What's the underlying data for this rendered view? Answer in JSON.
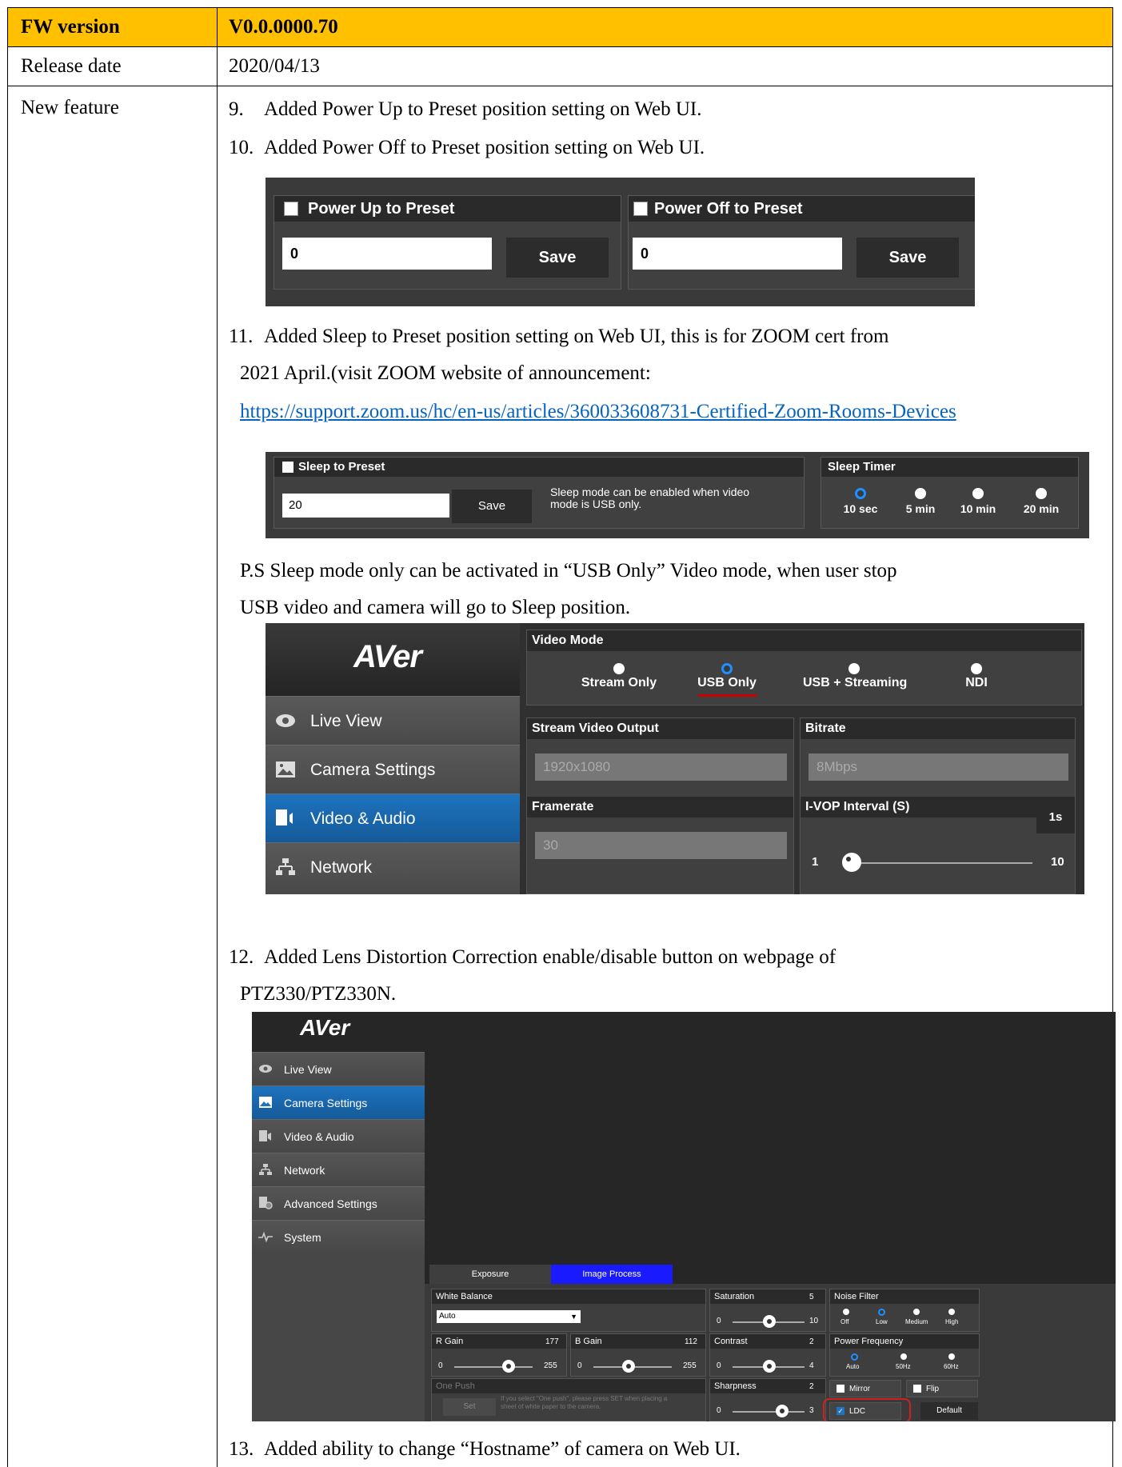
{
  "table": {
    "fw_label": "FW version",
    "fw_value": "V0.0.0000.70",
    "release_label": "Release date",
    "release_value": "2020/04/13",
    "feature_label": "New feature"
  },
  "items": [
    {
      "num": "9.",
      "text": "Added Power Up to Preset position setting on Web UI."
    },
    {
      "num": "10.",
      "text": "Added Power Off to Preset position setting on Web UI."
    },
    {
      "num": "11.",
      "text": "Added Sleep to Preset position setting on Web UI, this is for ZOOM cert from"
    },
    {
      "num": "12.",
      "text": "Added Lens Distortion Correction enable/disable button on webpage of"
    },
    {
      "num": "13.",
      "text": "Added ability to change “Hostname” of camera on Web UI."
    }
  ],
  "item11_line2": "2021 April.(visit ZOOM website of announcement:",
  "item11_link": "https://support.zoom.us/hc/en-us/articles/360033608731-Certified-Zoom-Rooms-Devices",
  "ps_line1": "P.S Sleep mode only can be activated in “USB Only” Video mode, when user stop",
  "ps_line2": "USB video and camera will go to Sleep position.",
  "item12_line2": "PTZ330/PTZ330N.",
  "shot_preset": {
    "power_up": {
      "label": "Power Up to Preset",
      "value": "0",
      "save": "Save"
    },
    "power_off": {
      "label": "Power Off to Preset",
      "value": "0",
      "save": "Save"
    }
  },
  "shot_sleep": {
    "label": "Sleep to Preset",
    "value": "20",
    "save": "Save",
    "note_line1": "Sleep mode can be enabled when video",
    "note_line2": "mode is USB only.",
    "timer_label": "Sleep Timer",
    "options": [
      "10 sec",
      "5 min",
      "10 min",
      "20 min"
    ],
    "selected": "10 sec"
  },
  "shot_video": {
    "logo": "AVer",
    "nav": [
      "Live View",
      "Camera Settings",
      "Video & Audio",
      "Network"
    ],
    "nav_selected": "Video & Audio",
    "video_mode_label": "Video Mode",
    "modes": [
      "Stream Only",
      "USB Only",
      "USB + Streaming",
      "NDI"
    ],
    "mode_selected": "USB Only",
    "stream_output_label": "Stream Video Output",
    "stream_output_value": "1920x1080",
    "bitrate_label": "Bitrate",
    "bitrate_value": "8Mbps",
    "framerate_label": "Framerate",
    "framerate_value": "30",
    "ivop_label": "I-VOP Interval (S)",
    "ivop_value": "1s",
    "ivop_min": "1",
    "ivop_max": "10"
  },
  "shot_camera": {
    "logo": "AVer",
    "nav": [
      "Live View",
      "Camera Settings",
      "Video & Audio",
      "Network",
      "Advanced Settings",
      "System"
    ],
    "nav_selected": "Camera Settings",
    "tabs": [
      "Exposure",
      "Image Process"
    ],
    "tab_selected": "Image Process",
    "white_balance_label": "White Balance",
    "white_balance_value": "Auto",
    "r_gain_label": "R Gain",
    "r_gain_value": "177",
    "r_gain_min": "0",
    "r_gain_max": "255",
    "b_gain_label": "B Gain",
    "b_gain_value": "112",
    "b_gain_min": "0",
    "b_gain_max": "255",
    "one_push_label": "One Push",
    "one_push_set": "Set",
    "one_push_hint_line1": "If you select \"One push\", please press SET when placing a",
    "one_push_hint_line2": "sheet of white paper to the camera.",
    "saturation_label": "Saturation",
    "saturation_value": "5",
    "saturation_min": "0",
    "saturation_max": "10",
    "contrast_label": "Contrast",
    "contrast_value": "2",
    "contrast_min": "0",
    "contrast_max": "4",
    "sharpness_label": "Sharpness",
    "sharpness_value": "2",
    "sharpness_min": "0",
    "sharpness_max": "3",
    "noise_filter_label": "Noise Filter",
    "noise_options": [
      "Off",
      "Low",
      "Medium",
      "High"
    ],
    "noise_selected": "Low",
    "power_freq_label": "Power Frequency",
    "freq_options": [
      "Auto",
      "50Hz",
      "60Hz"
    ],
    "freq_selected": "Auto",
    "mirror_label": "Mirror",
    "flip_label": "Flip",
    "ldc_label": "LDC",
    "default_label": "Default"
  }
}
